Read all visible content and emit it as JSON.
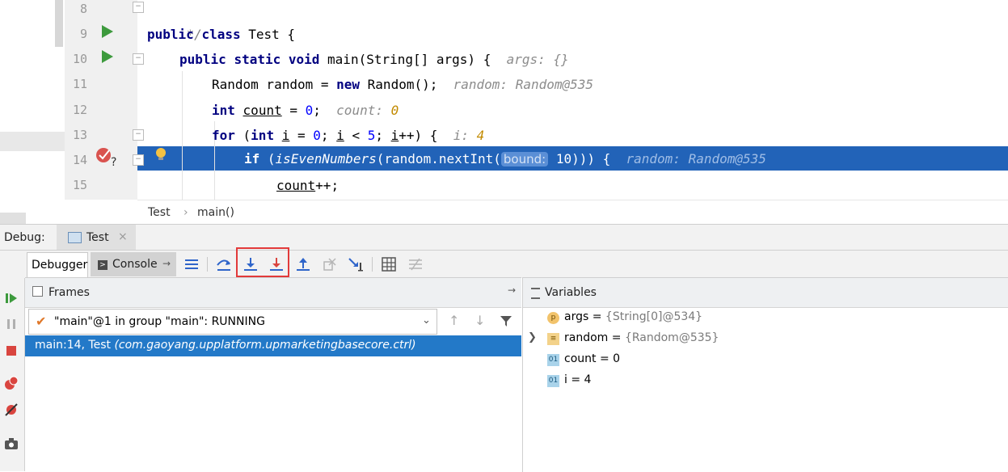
{
  "editor": {
    "line_numbers": [
      "8",
      "9",
      "10",
      "11",
      "12",
      "13",
      "14",
      "15"
    ],
    "lines": {
      "l8": {
        "comment": "*/"
      },
      "l9": {
        "kw1": "public",
        "kw2": "class",
        "rest": " Test {"
      },
      "l10": {
        "kw1": "public",
        "kw2": "static",
        "kw3": "void",
        "rest": " main(String[] args) {",
        "hint": "args: {}"
      },
      "l11": {
        "pre": "Random random = ",
        "kw": "new",
        "post": " Random();",
        "hint": "random: Random@535"
      },
      "l12": {
        "kw": "int",
        "var": "count",
        "post": " = ",
        "num": "0",
        "semi": ";",
        "hint_name": "count: ",
        "hint_val": "0"
      },
      "l13": {
        "kw1": "for",
        "p1": " (",
        "kw2": "int",
        "v1": "i",
        "p2": " = ",
        "n1": "0",
        "p3": "; ",
        "v2": "i",
        "p4": " < ",
        "n2": "5",
        "p5": "; ",
        "v3": "i",
        "p6": "++) {",
        "hint_name": "i: ",
        "hint_val": "4"
      },
      "l14": {
        "kw": "if",
        "p1": " (",
        "fn": "isEvenNumbers",
        "p2": "(random.nextInt(",
        "param": "bound:",
        "p3": " 10))) {",
        "hint": "random: Random@535"
      },
      "l15": {
        "var": "count",
        "post": "++;"
      }
    }
  },
  "breadcrumb": {
    "class_name": "Test",
    "separator": "›",
    "method_name": "main()"
  },
  "debug_window": {
    "label": "Debug:",
    "session_tab": "Test",
    "close_glyph": "×",
    "tabs": {
      "debugger": "Debugger",
      "console": "Console"
    }
  },
  "frames": {
    "title": "Frames",
    "thread": "\"main\"@1 in group \"main\": RUNNING",
    "selected_frame": {
      "location": "main:14, Test",
      "package": "(com.gaoyang.upplatform.upmarketingbasecore.ctrl)"
    }
  },
  "variables": {
    "title": "Variables",
    "items": [
      {
        "icon": "p",
        "name": "args",
        "eq": " = ",
        "value": "{String[0]@534}",
        "expandable": false
      },
      {
        "icon": "≡",
        "name": "random",
        "eq": " = ",
        "value": "{Random@535}",
        "expandable": true
      },
      {
        "icon": "01",
        "name": "count",
        "eq": " = ",
        "value": "0",
        "expandable": false
      },
      {
        "icon": "01",
        "name": "i",
        "eq": " = ",
        "value": "4",
        "expandable": false
      }
    ]
  },
  "colors": {
    "selection_blue": "#2263b8",
    "frame_selection": "#2379c8",
    "keyword": "#000080",
    "number": "#0000ff",
    "annotation_box": "#e23a3a"
  }
}
